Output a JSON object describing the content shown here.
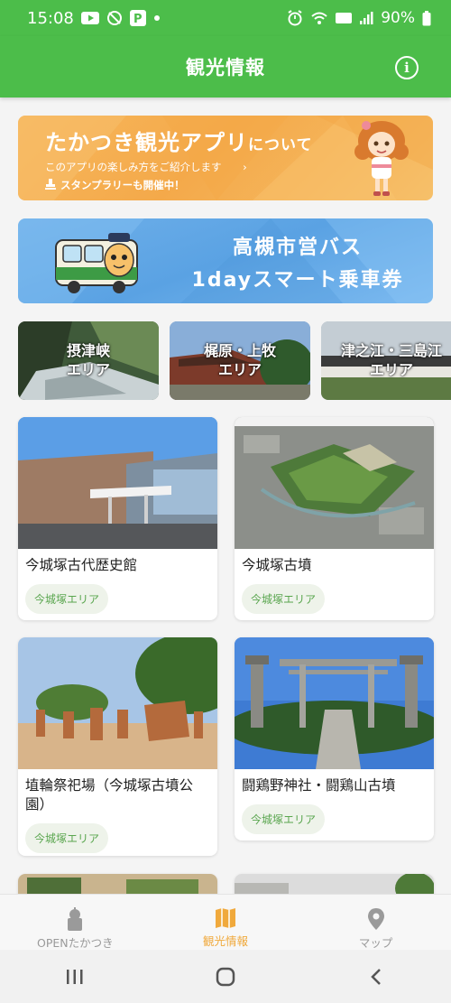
{
  "status_bar": {
    "time": "15:08",
    "battery": "90%"
  },
  "header": {
    "title": "観光情報"
  },
  "banners": {
    "app": {
      "title_main": "たかつき観光アプリ",
      "title_suffix": "について",
      "subtitle": "このアプリの楽しみ方をご紹介します",
      "arrow": "›",
      "stamp_note": "スタンプラリーも開催中！"
    },
    "bus": {
      "line1": "高槻市営バス",
      "line2": "1dayスマート乗車券"
    }
  },
  "areas": [
    {
      "label_line1": "摂津峡",
      "label_line2": "エリア"
    },
    {
      "label_line1": "梶原・上牧",
      "label_line2": "エリア"
    },
    {
      "label_line1": "津之江・三島江",
      "label_line2": "エリア"
    }
  ],
  "spots": [
    {
      "name": "今城塚古代歴史館",
      "tag": "今城塚エリア"
    },
    {
      "name": "今城塚古墳",
      "tag": "今城塚エリア"
    },
    {
      "name": "埴輪祭祀場（今城塚古墳公園）",
      "tag": "今城塚エリア"
    },
    {
      "name": "闘鶏野神社・闘鶏山古墳",
      "tag": "今城塚エリア"
    }
  ],
  "bottom_nav": [
    {
      "label": "OPENたかつき",
      "icon": "open-takatsuki-icon",
      "active": false
    },
    {
      "label": "観光情報",
      "icon": "map-book-icon",
      "active": true
    },
    {
      "label": "マップ",
      "icon": "map-pin-icon",
      "active": false
    }
  ],
  "colors": {
    "brand_green": "#4cbd4a",
    "active_orange": "#f0a93c",
    "tag_green": "#5aa64f"
  }
}
